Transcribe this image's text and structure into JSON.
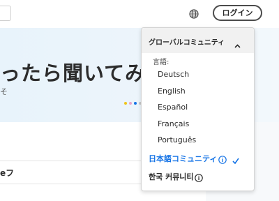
{
  "header": {
    "login_label": "ログイン",
    "globe_icon": "globe-icon"
  },
  "hero": {
    "title": "ったら聞いてみ",
    "subtitle": "そ",
    "dot_colors": [
      "#f0c419",
      "#e9a3c9",
      "#1473e6",
      "#c8c8c8"
    ]
  },
  "content": {
    "fragment": "eフ"
  },
  "language_menu": {
    "header_label": "グローバルコミュニティ",
    "section_label": "言語:",
    "languages": [
      "Deutsch",
      "English",
      "Español",
      "Français",
      "Português"
    ],
    "japanese_community": "日本語コミュニティ",
    "korean_community": "한국 커뮤니티"
  },
  "colors": {
    "accent": "#1473e6",
    "hero_bg": "#e8f3fb"
  }
}
